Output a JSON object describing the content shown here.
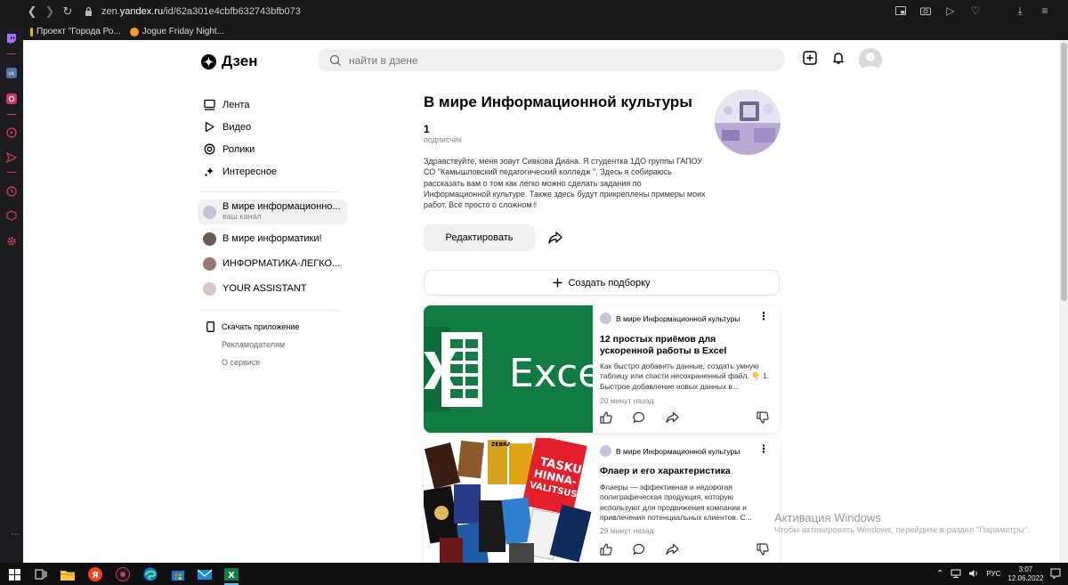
{
  "browser": {
    "url_prefix": "zen.",
    "url_domain": "yandex.ru",
    "url_path": "/id/62a301e4cbfb632743bfb073",
    "bookmarks": [
      {
        "label": "Проект \"Города Ро...",
        "color": "#e8b400"
      },
      {
        "label": "Jogue Friday Night...",
        "color": "#f0a020"
      }
    ]
  },
  "header": {
    "logo": "Дзен",
    "search_placeholder": "найти в дзене"
  },
  "sidebar": {
    "nav": [
      {
        "label": "Лента",
        "icon": "feed-icon"
      },
      {
        "label": "Видео",
        "icon": "play-icon"
      },
      {
        "label": "Ролики",
        "icon": "shorts-icon"
      },
      {
        "label": "Интересное",
        "icon": "sparkle-icon"
      }
    ],
    "channels": [
      {
        "name": "В мире информационно...",
        "sub": "ваш канал",
        "active": true,
        "color": "#c9c3d8"
      },
      {
        "name": "В мире информатики!",
        "sub": "",
        "active": false,
        "color": "#6b5a55"
      },
      {
        "name": "ИНФОРМАТИКА-ЛЕГКО...",
        "sub": "",
        "active": false,
        "color": "#9a7a70"
      },
      {
        "name": "YOUR ASSISTANT",
        "sub": "",
        "active": false,
        "color": "#d8c8c4"
      }
    ],
    "app_link": "Скачать приложение",
    "links": [
      "Рекламодателям",
      "О сервисе"
    ]
  },
  "channel": {
    "title": "В мире Информационной культуры",
    "subscribers_count": "1",
    "subscribers_label": "подписчик",
    "description": "Здравствуйте, меня зовут Сивкова Диана. Я студентка 1ДО группы ГАПОУ СО \"Камышловский педагогический колледж \". Здесь я собираюсь рассказать вам о том как легко можно сделать задания по Информационной культуре. Также здесь будут прикреплены примеры моих работ. Всё просто о сложном✌",
    "edit_label": "Редактировать",
    "create_label": "Создать подборку"
  },
  "cards": [
    {
      "source": "В мире Информационной культуры",
      "title": "12 простых приёмов для ускоренной работы в Excel",
      "text": "Как быстро добавить данные, создать умную таблицу или спасти несохраненный файл. 👇 1. Быстрое добавление новых данных в...",
      "time": "20 минут назад",
      "image_text": "Excel",
      "accent": "#107c41"
    },
    {
      "source": "В мире Информационной культуры",
      "title": "Флаер и его характеристика",
      "text": "Флаеры — эффективная и недорогая полиграфическая продукция, которую используют для продвижения компании и привлечения потенциальных клиентов. С...",
      "time": "29 минут назад",
      "image_text_1": "TASKU",
      "image_text_2": "HINNA-",
      "image_text_3": "VALITSUS",
      "image_text_4": "ZEBRA"
    }
  ],
  "watermark": {
    "title": "Активация Windows",
    "text": "Чтобы активировать Windows, перейдите в раздел \"Параметры\"."
  },
  "taskbar": {
    "lang": "РУС",
    "time": "3:07",
    "date": "12.06.2022"
  }
}
